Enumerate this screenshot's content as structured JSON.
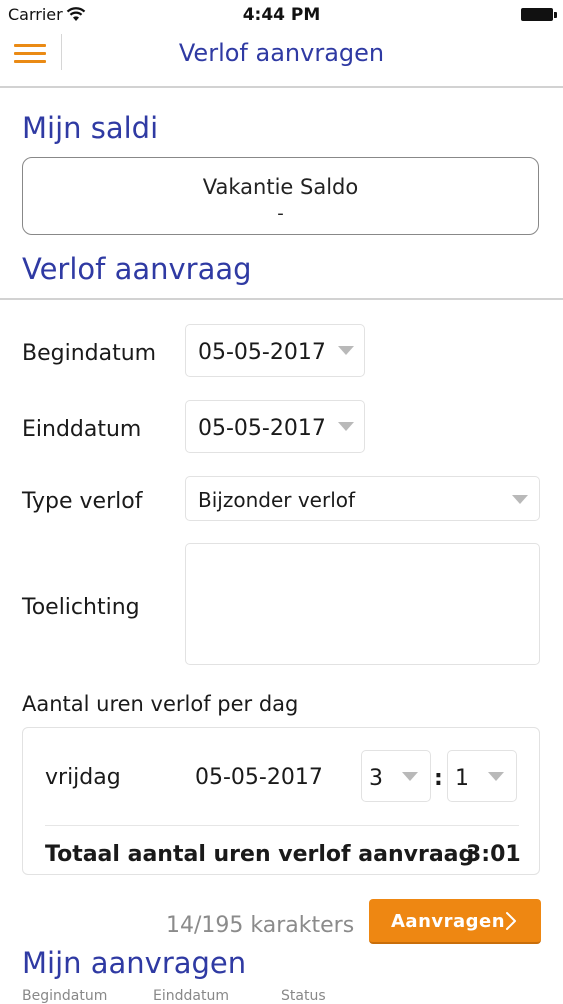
{
  "status_bar": {
    "carrier": "Carrier",
    "time": "4:44 PM",
    "icons": [
      "wifi-icon",
      "battery-icon"
    ]
  },
  "nav": {
    "title": "Verlof aanvragen",
    "menu_icon": "hamburger-menu-icon",
    "accent_color": "#ea8a14",
    "title_color": "#2f3aa3"
  },
  "balances": {
    "title": "Mijn saldi",
    "vacation_label": "Vakantie Saldo",
    "vacation_value": "-"
  },
  "request_form": {
    "title": "Verlof aanvraag",
    "start_date_label": "Begindatum",
    "start_date_value": "05-05-2017",
    "end_date_label": "Einddatum",
    "end_date_value": "05-05-2017",
    "leave_type_label": "Type verlof",
    "leave_type_value": "Bijzonder verlof",
    "comment_label": "Toelichting",
    "comment_value": "",
    "hours_title": "Aantal uren verlof per dag",
    "hours_rows": [
      {
        "day": "vrijdag",
        "date": "05-05-2017",
        "hours": "3",
        "minutes": "1"
      }
    ],
    "hours_separator": ":",
    "total_label": "Totaal aantal uren verlof aanvraag",
    "total_value": "3:01",
    "char_count": "14/195 karakters",
    "submit_label": "Aanvragen",
    "submit_color": "#ee8712"
  },
  "my_requests": {
    "title": "Mijn aanvragen",
    "columns": [
      "Begindatum",
      "Einddatum",
      "Status"
    ]
  }
}
